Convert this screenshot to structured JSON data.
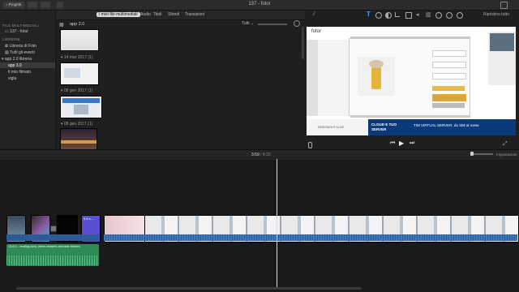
{
  "window": {
    "title": "137 - fotor",
    "projects_button": "Progetti",
    "reset_label": "Ripristina tutto"
  },
  "sidebar": {
    "media_header": "FILE MULTIMEDIALI",
    "project_item": "137 - fotor",
    "library_header": "LIBRERIE",
    "items": [
      {
        "label": "Libreria di Foto"
      },
      {
        "label": "Tutti gli eventi"
      },
      {
        "label": "app 2.0 libreria"
      },
      {
        "label": "app 3.0"
      },
      {
        "label": "Il mio filmato"
      },
      {
        "label": "vigla"
      }
    ]
  },
  "browser": {
    "tabs": [
      {
        "label": "I miei file multimediali"
      },
      {
        "label": "Audio"
      },
      {
        "label": "Titoli"
      },
      {
        "label": "Sfondi"
      },
      {
        "label": "Transizioni"
      }
    ],
    "event_name": "app 2.0",
    "filter_label": "Tutti",
    "groups": [
      {
        "label": "14 mar 2017   (1)"
      },
      {
        "label": "08 gen 2017   (1)"
      },
      {
        "label": "08 gen 2017   (1)"
      }
    ]
  },
  "viewer": {
    "site_logo": "fotor",
    "ad_left": "DESIGNIGHT ALIVE",
    "ad_cloud": "CLOUD E TUO SERVER",
    "ad_tim": "TIM VIRTUAL SERVER, da 30€ al mese"
  },
  "timeline": {
    "time_current": "3:59",
    "time_total": "4:22",
    "settings_label": "Impostazioni",
    "clip_label": "5,6 s –",
    "audio_label": "13,6 s – ending-cunk_fame-chasers-and-star-flickers"
  },
  "colors": {
    "accent": "#f0a63a",
    "audio": "#2e8a57",
    "title_clip": "#5a4fd0"
  }
}
